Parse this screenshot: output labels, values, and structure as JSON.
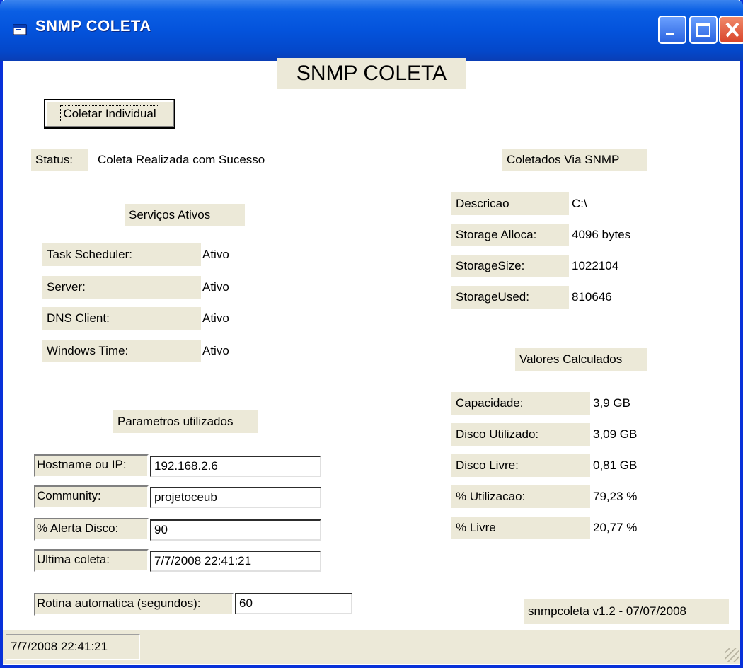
{
  "window": {
    "title": "SNMP COLETA"
  },
  "heading": "SNMP COLETA",
  "coletar_button": "Coletar Individual",
  "status": {
    "label": "Status:",
    "value": "Coleta Realizada com Sucesso"
  },
  "servicos": {
    "title": "Serviços Ativos",
    "items": [
      {
        "name": "Task Scheduler:",
        "state": "Ativo"
      },
      {
        "name": "Server:",
        "state": "Ativo"
      },
      {
        "name": "DNS Client:",
        "state": "Ativo"
      },
      {
        "name": "Windows Time:",
        "state": "Ativo"
      }
    ]
  },
  "parametros": {
    "title": "Parametros utilizados",
    "fields": [
      {
        "label": "Hostname ou IP:",
        "value": "192.168.2.6"
      },
      {
        "label": "Community:",
        "value": "projetoceub"
      },
      {
        "label": "% Alerta Disco:",
        "value": "90"
      },
      {
        "label": "Ultima coleta:",
        "value": "7/7/2008 22:41:21"
      }
    ],
    "rotina": {
      "label": "Rotina automatica (segundos):",
      "value": "60"
    }
  },
  "snmp": {
    "title": "Coletados Via SNMP",
    "items": [
      {
        "label": "Descricao",
        "value": "C:\\"
      },
      {
        "label": "Storage Alloca:",
        "value": "4096 bytes"
      },
      {
        "label": "StorageSize:",
        "value": "1022104"
      },
      {
        "label": "StorageUsed:",
        "value": "810646"
      }
    ]
  },
  "calculados": {
    "title": "Valores Calculados",
    "items": [
      {
        "label": "Capacidade:",
        "value": "3,9 GB"
      },
      {
        "label": "Disco Utilizado:",
        "value": "3,09 GB"
      },
      {
        "label": "Disco Livre:",
        "value": "0,81 GB"
      },
      {
        "label": "% Utilizacao:",
        "value": "79,23 %"
      },
      {
        "label": "% Livre",
        "value": "20,77 %"
      }
    ]
  },
  "version": "snmpcoleta v1.2 - 07/07/2008",
  "statusbar": {
    "text": "7/7/2008 22:41:21"
  },
  "colors": {
    "title_blue": "#0453dc",
    "panel": "#ece9d8",
    "close_red": "#d8442a"
  }
}
